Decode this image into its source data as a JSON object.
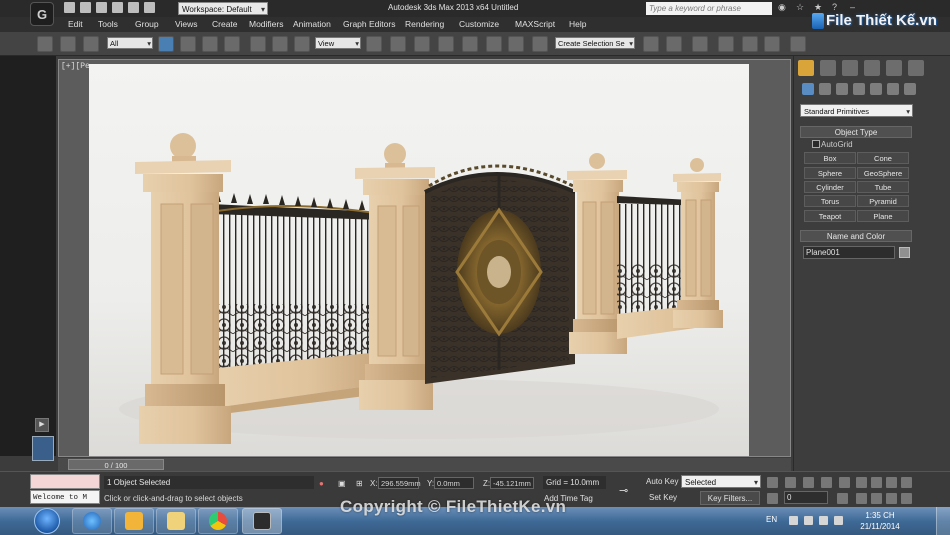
{
  "window": {
    "title": "Autodesk 3ds Max  2013 x64     Untitled",
    "workspace": "Workspace: Default",
    "search_placeholder": "Type a keyword or phrase"
  },
  "menu": [
    "Edit",
    "Tools",
    "Group",
    "Views",
    "Create",
    "Modifiers",
    "Animation",
    "Graph Editors",
    "Rendering",
    "Customize",
    "MAXScript",
    "Help"
  ],
  "toolbar": {
    "filter": "All",
    "ref_coord": "View",
    "selection_set": "Create Selection Se"
  },
  "viewport": {
    "label": "[+][Pe"
  },
  "timeline": {
    "frame": "0 / 100"
  },
  "status": {
    "selection": "1 Object Selected",
    "prompt": "Click or click-and-drag to select objects",
    "maxscript": "Welcome to M",
    "x_label": "X:",
    "x_value": "296.559mm",
    "y_label": "Y:",
    "y_value": "0.0mm",
    "z_label": "Z:",
    "z_value": "-45.121mm",
    "grid": "Grid = 10.0mm",
    "add_time_tag": "Add Time Tag",
    "auto_key": "Auto Key",
    "set_key": "Set Key",
    "key_mode": "Selected",
    "key_filters": "Key Filters...",
    "current_frame": "0"
  },
  "command_panel": {
    "category": "Standard Primitives",
    "object_type_title": "Object Type",
    "autogrid": "AutoGrid",
    "object_buttons": [
      "Box",
      "Cone",
      "Sphere",
      "GeoSphere",
      "Cylinder",
      "Tube",
      "Torus",
      "Pyramid",
      "Teapot",
      "Plane"
    ],
    "name_color_title": "Name and Color",
    "object_name": "Plane001"
  },
  "taskbar": {
    "language": "EN",
    "time": "1:35 CH",
    "date": "21/11/2014"
  },
  "watermark": {
    "copyright": "Copyright © FileThietKe.vn",
    "logo": "File Thiết Kế.vn"
  },
  "colors": {
    "viewport_bg": "#5c5c5c",
    "render_bg": "#f0f0ee",
    "stone": "#e8cda8",
    "iron": "#2a2622",
    "gold_ornament": "#8a6a2e",
    "taskbar": "#3f6a97"
  }
}
